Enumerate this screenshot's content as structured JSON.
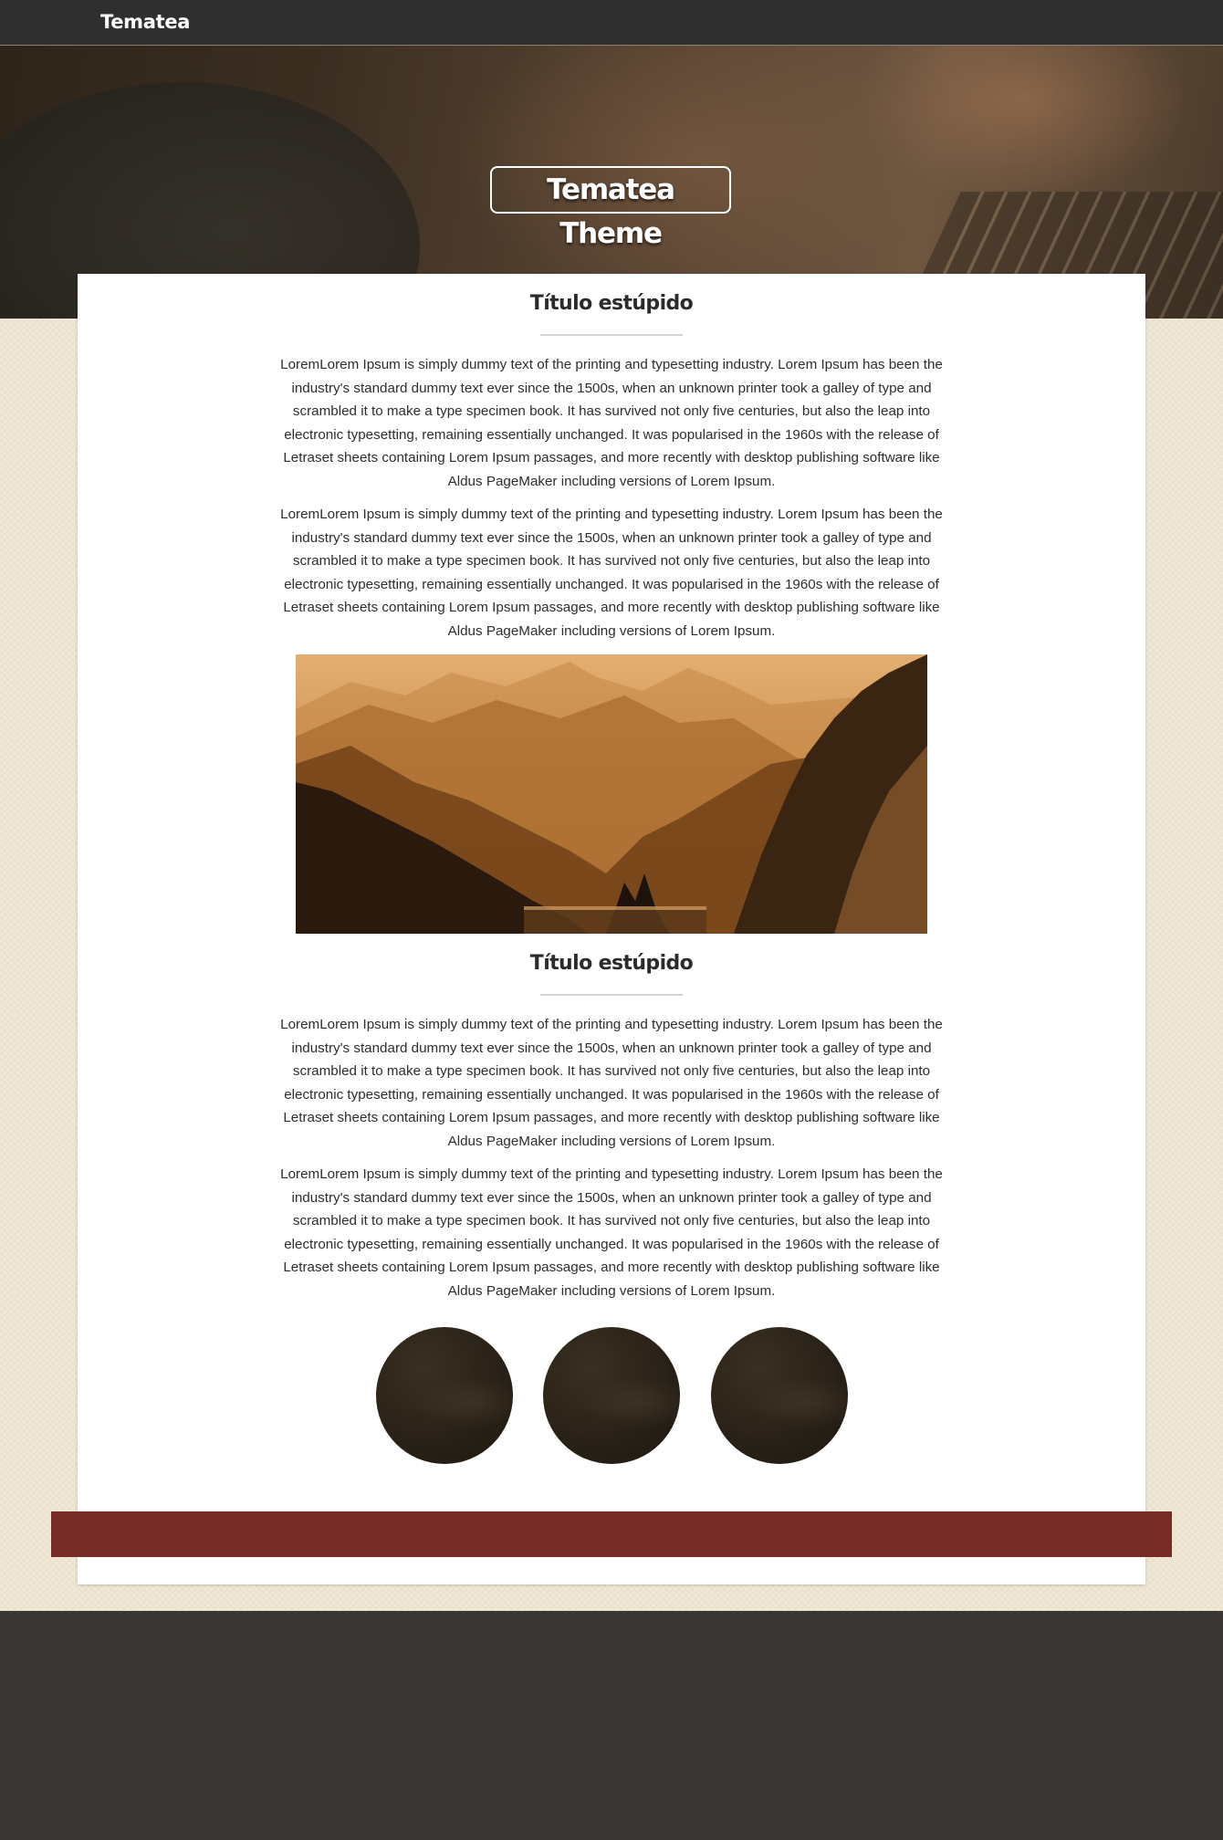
{
  "navbar": {
    "brand": "Tematea"
  },
  "hero": {
    "title": "Tematea Theme"
  },
  "main": {
    "sections": [
      {
        "title": "Título estúpido",
        "paragraphs": [
          "LoremLorem Ipsum is simply dummy text of the printing and typesetting industry. Lorem Ipsum has been the industry's standard dummy text ever since the 1500s, when an unknown printer took a galley of type and scrambled it to make a type specimen book. It has survived not only five centuries, but also the leap into electronic typesetting, remaining essentially unchanged. It was popularised in the 1960s with the release of Letraset sheets containing Lorem Ipsum passages, and more recently with desktop publishing software like Aldus PageMaker including versions of Lorem Ipsum.",
          "LoremLorem Ipsum is simply dummy text of the printing and typesetting industry. Lorem Ipsum has been the industry's standard dummy text ever since the 1500s, when an unknown printer took a galley of type and scrambled it to make a type specimen book. It has survived not only five centuries, but also the leap into electronic typesetting, remaining essentially unchanged. It was popularised in the 1960s with the release of Letraset sheets containing Lorem Ipsum passages, and more recently with desktop publishing software like Aldus PageMaker including versions of Lorem Ipsum."
        ]
      },
      {
        "title": "Título estúpido",
        "paragraphs": [
          "LoremLorem Ipsum is simply dummy text of the printing and typesetting industry. Lorem Ipsum has been the industry's standard dummy text ever since the 1500s, when an unknown printer took a galley of type and scrambled it to make a type specimen book. It has survived not only five centuries, but also the leap into electronic typesetting, remaining essentially unchanged. It was popularised in the 1960s with the release of Letraset sheets containing Lorem Ipsum passages, and more recently with desktop publishing software like Aldus PageMaker including versions of Lorem Ipsum.",
          "LoremLorem Ipsum is simply dummy text of the printing and typesetting industry. Lorem Ipsum has been the industry's standard dummy text ever since the 1500s, when an unknown printer took a galley of type and scrambled it to make a type specimen book. It has survived not only five centuries, but also the leap into electronic typesetting, remaining essentially unchanged. It was popularised in the 1960s with the release of Letraset sheets containing Lorem Ipsum passages, and more recently with desktop publishing software like Aldus PageMaker including versions of Lorem Ipsum."
        ]
      }
    ]
  },
  "colors": {
    "navbar": "#2f2f2f",
    "page_background": "#f0e8d7",
    "banner": "#772d27",
    "footer": "#373633",
    "title_text": "#2b2b2b"
  }
}
